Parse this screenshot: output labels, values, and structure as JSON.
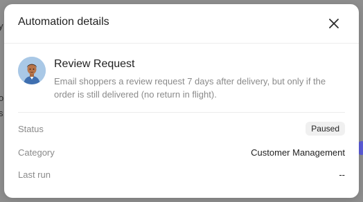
{
  "background": {
    "fragment_1": "y",
    "fragment_2": "o",
    "fragment_3": "s"
  },
  "modal": {
    "title": "Automation details",
    "close_icon": "close-icon",
    "automation": {
      "avatar_icon": "avatar",
      "name": "Review Request",
      "description": "Email shoppers a review request 7 days after delivery, but only if the order is still delivered (no return in flight)."
    },
    "details": {
      "status_label": "Status",
      "status_value": "Paused",
      "category_label": "Category",
      "category_value": "Customer Management",
      "last_run_label": "Last run",
      "last_run_value": "--"
    }
  },
  "colors": {
    "overlay": "#8e8e8e",
    "accent": "#5b5bd6",
    "badge_bg": "#f0f0f0"
  }
}
